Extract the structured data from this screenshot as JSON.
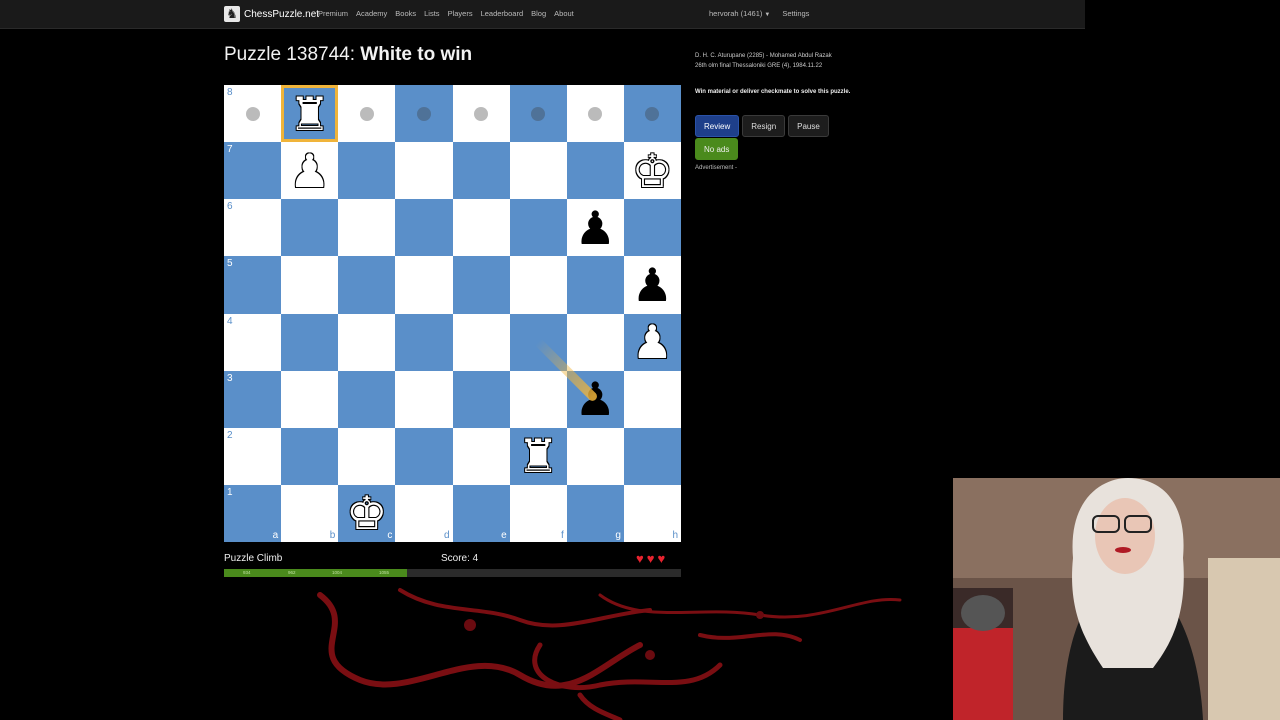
{
  "navbar": {
    "brand": "ChessPuzzle.net",
    "links": [
      "Premium",
      "Academy",
      "Books",
      "Lists",
      "Players",
      "Leaderboard",
      "Blog",
      "About"
    ],
    "user": "hervorah (1461)",
    "settings": "Settings"
  },
  "puzzle": {
    "title_prefix": "Puzzle 138744:",
    "title_goal": "White to win"
  },
  "board": {
    "ranks": [
      "8",
      "7",
      "6",
      "5",
      "4",
      "3",
      "2",
      "1"
    ],
    "files": [
      "a",
      "b",
      "c",
      "d",
      "e",
      "f",
      "g",
      "h"
    ],
    "highlight": "b8",
    "move_dots": [
      "a8",
      "c8",
      "d8",
      "e8",
      "f8",
      "g8",
      "h8"
    ],
    "last_move_arrow": {
      "from": "f4",
      "to": "g3",
      "color": "#f0b43a"
    },
    "pieces": [
      {
        "square": "b8",
        "glyph": "♜",
        "color": "white",
        "name": "white-rook"
      },
      {
        "square": "b7",
        "glyph": "♟",
        "color": "white",
        "name": "white-pawn"
      },
      {
        "square": "h7",
        "glyph": "♚",
        "color": "white",
        "name": "white-king"
      },
      {
        "square": "g6",
        "glyph": "♟",
        "color": "black",
        "name": "black-pawn"
      },
      {
        "square": "h5",
        "glyph": "♟",
        "color": "black",
        "name": "black-pawn"
      },
      {
        "square": "h4",
        "glyph": "♟",
        "color": "white",
        "name": "white-pawn"
      },
      {
        "square": "g3",
        "glyph": "♟",
        "color": "black",
        "name": "black-pawn"
      },
      {
        "square": "f2",
        "glyph": "♜",
        "color": "white",
        "name": "white-rook"
      },
      {
        "square": "c1",
        "glyph": "♚",
        "color": "white",
        "name": "white-king"
      }
    ]
  },
  "footer": {
    "climb_label": "Puzzle Climb",
    "score_label": "Score: 4",
    "lives": 3,
    "progress_fraction": 0.4,
    "progress_ticks": [
      "934",
      "962",
      "1004",
      "1055"
    ]
  },
  "sidebar": {
    "players": "D. H. C. Aturupane (2285) - Mohamed Abdul Razak",
    "event": "26th olm final Thessaloniki GRE (4), 1984.11.22",
    "instructions": "Win material or deliver checkmate to solve this puzzle.",
    "buttons": {
      "review": "Review",
      "resign": "Resign",
      "pause": "Pause",
      "no_ads": "No ads"
    },
    "advertisement": "Advertisement -"
  },
  "colors": {
    "dark_square": "#5a8fc9",
    "light_square": "#ffffff",
    "highlight": "#f0b43a",
    "progress": "#4a8a1c",
    "hearts": "#e8232f"
  }
}
